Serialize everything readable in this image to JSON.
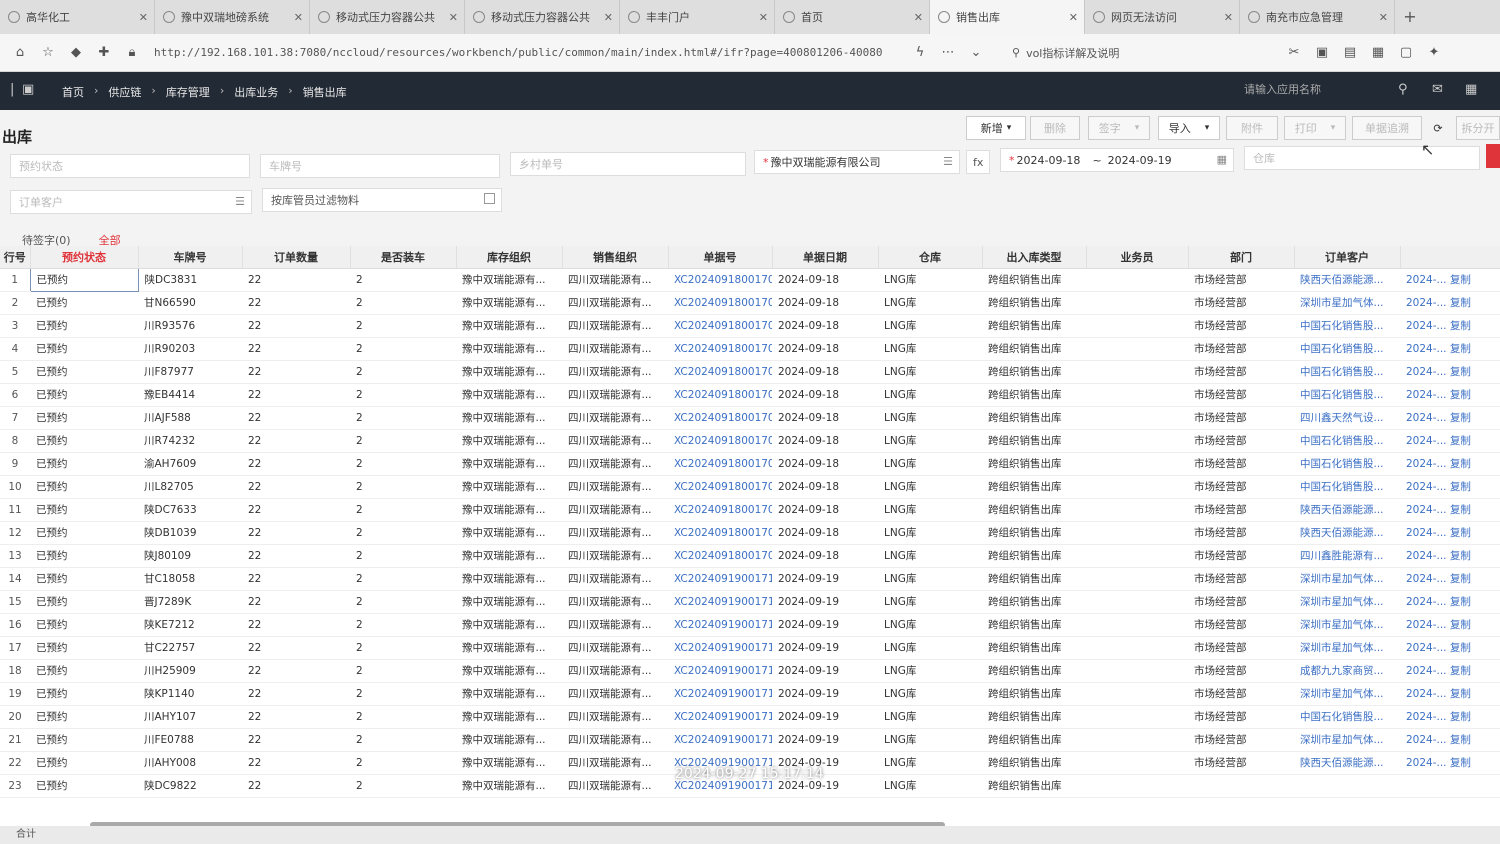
{
  "browser": {
    "tabs": [
      {
        "label": "高华化工",
        "active": false
      },
      {
        "label": "豫中双瑞地磅系统",
        "active": false
      },
      {
        "label": "移动式压力容器公共",
        "active": false
      },
      {
        "label": "移动式压力容器公共",
        "active": false
      },
      {
        "label": "丰丰门户",
        "active": false
      },
      {
        "label": "首页",
        "active": false
      },
      {
        "label": "销售出库",
        "active": true
      },
      {
        "label": "网页无法访问",
        "active": false
      },
      {
        "label": "南充市应急管理",
        "active": false
      }
    ],
    "url": "http://192.168.101.38:7080/nccloud/resources/workbench/public/common/main/index.html#/ifr?page=400801206-40080",
    "search_text": "vol指标详解及说明"
  },
  "topnav": {
    "breadcrumbs": [
      "首页",
      "供应链",
      "库存管理",
      "出库业务",
      "销售出库"
    ],
    "app_search_placeholder": "请输入应用名称"
  },
  "page": {
    "title": "出库",
    "toolbar": {
      "add": "新增",
      "delete": "删除",
      "sign": "签字",
      "import": "导入",
      "attach": "附件",
      "print": "打印",
      "track": "单据追溯",
      "split": "拆分开"
    },
    "filters": {
      "status_placeholder": "预约状态",
      "plate_placeholder": "车牌号",
      "village_placeholder": "乡村单号",
      "org_value": "豫中双瑞能源有限公司",
      "date_from": "2024-09-18",
      "date_to": "2024-09-19",
      "warehouse_placeholder": "仓库",
      "customer_placeholder": "订单客户",
      "material_filter_label": "按库管员过滤物料"
    },
    "subtabs": {
      "pending": "待签字(0)",
      "all": "全部"
    }
  },
  "table": {
    "columns": [
      "行号",
      "预约状态",
      "车牌号",
      "订单数量",
      "是否装车",
      "库存组织",
      "销售组织",
      "单据号",
      "单据日期",
      "仓库",
      "出入库类型",
      "业务员",
      "部门",
      "订单客户",
      ""
    ],
    "rows": [
      {
        "n": "1",
        "status": "已预约",
        "plate": "陕DC3831",
        "qty": "22",
        "load": "2",
        "stock_org": "豫中双瑞能源有...",
        "sales_org": "四川双瑞能源有...",
        "bill": "XC2024091800170...",
        "date": "2024-09-18",
        "wh": "LNG库",
        "type": "跨组织销售出库",
        "clerk": "",
        "dept": "市场经营部",
        "cust": "陕西天佰源能源...",
        "extra": "2024-... 复制"
      },
      {
        "n": "2",
        "status": "已预约",
        "plate": "甘N66590",
        "qty": "22",
        "load": "2",
        "stock_org": "豫中双瑞能源有...",
        "sales_org": "四川双瑞能源有...",
        "bill": "XC2024091800170...",
        "date": "2024-09-18",
        "wh": "LNG库",
        "type": "跨组织销售出库",
        "clerk": "",
        "dept": "市场经营部",
        "cust": "深圳市星加气体...",
        "extra": "2024-... 复制"
      },
      {
        "n": "3",
        "status": "已预约",
        "plate": "川R93576",
        "qty": "22",
        "load": "2",
        "stock_org": "豫中双瑞能源有...",
        "sales_org": "四川双瑞能源有...",
        "bill": "XC2024091800170...",
        "date": "2024-09-18",
        "wh": "LNG库",
        "type": "跨组织销售出库",
        "clerk": "",
        "dept": "市场经营部",
        "cust": "中国石化销售股...",
        "extra": "2024-... 复制"
      },
      {
        "n": "4",
        "status": "已预约",
        "plate": "川R90203",
        "qty": "22",
        "load": "2",
        "stock_org": "豫中双瑞能源有...",
        "sales_org": "四川双瑞能源有...",
        "bill": "XC2024091800170...",
        "date": "2024-09-18",
        "wh": "LNG库",
        "type": "跨组织销售出库",
        "clerk": "",
        "dept": "市场经营部",
        "cust": "中国石化销售股...",
        "extra": "2024-... 复制"
      },
      {
        "n": "5",
        "status": "已预约",
        "plate": "川F87977",
        "qty": "22",
        "load": "2",
        "stock_org": "豫中双瑞能源有...",
        "sales_org": "四川双瑞能源有...",
        "bill": "XC2024091800170...",
        "date": "2024-09-18",
        "wh": "LNG库",
        "type": "跨组织销售出库",
        "clerk": "",
        "dept": "市场经营部",
        "cust": "中国石化销售股...",
        "extra": "2024-... 复制"
      },
      {
        "n": "6",
        "status": "已预约",
        "plate": "豫EB4414",
        "qty": "22",
        "load": "2",
        "stock_org": "豫中双瑞能源有...",
        "sales_org": "四川双瑞能源有...",
        "bill": "XC2024091800170...",
        "date": "2024-09-18",
        "wh": "LNG库",
        "type": "跨组织销售出库",
        "clerk": "",
        "dept": "市场经营部",
        "cust": "中国石化销售股...",
        "extra": "2024-... 复制"
      },
      {
        "n": "7",
        "status": "已预约",
        "plate": "川AJF588",
        "qty": "22",
        "load": "2",
        "stock_org": "豫中双瑞能源有...",
        "sales_org": "四川双瑞能源有...",
        "bill": "XC2024091800170...",
        "date": "2024-09-18",
        "wh": "LNG库",
        "type": "跨组织销售出库",
        "clerk": "",
        "dept": "市场经营部",
        "cust": "四川鑫天然气设...",
        "extra": "2024-... 复制"
      },
      {
        "n": "8",
        "status": "已预约",
        "plate": "川R74232",
        "qty": "22",
        "load": "2",
        "stock_org": "豫中双瑞能源有...",
        "sales_org": "四川双瑞能源有...",
        "bill": "XC2024091800170...",
        "date": "2024-09-18",
        "wh": "LNG库",
        "type": "跨组织销售出库",
        "clerk": "",
        "dept": "市场经营部",
        "cust": "中国石化销售股...",
        "extra": "2024-... 复制"
      },
      {
        "n": "9",
        "status": "已预约",
        "plate": "渝AH7609",
        "qty": "22",
        "load": "2",
        "stock_org": "豫中双瑞能源有...",
        "sales_org": "四川双瑞能源有...",
        "bill": "XC2024091800170...",
        "date": "2024-09-18",
        "wh": "LNG库",
        "type": "跨组织销售出库",
        "clerk": "",
        "dept": "市场经营部",
        "cust": "中国石化销售股...",
        "extra": "2024-... 复制"
      },
      {
        "n": "10",
        "status": "已预约",
        "plate": "川L82705",
        "qty": "22",
        "load": "2",
        "stock_org": "豫中双瑞能源有...",
        "sales_org": "四川双瑞能源有...",
        "bill": "XC2024091800170...",
        "date": "2024-09-18",
        "wh": "LNG库",
        "type": "跨组织销售出库",
        "clerk": "",
        "dept": "市场经营部",
        "cust": "中国石化销售股...",
        "extra": "2024-... 复制"
      },
      {
        "n": "11",
        "status": "已预约",
        "plate": "陕DC7633",
        "qty": "22",
        "load": "2",
        "stock_org": "豫中双瑞能源有...",
        "sales_org": "四川双瑞能源有...",
        "bill": "XC2024091800170...",
        "date": "2024-09-18",
        "wh": "LNG库",
        "type": "跨组织销售出库",
        "clerk": "",
        "dept": "市场经营部",
        "cust": "陕西天佰源能源...",
        "extra": "2024-... 复制"
      },
      {
        "n": "12",
        "status": "已预约",
        "plate": "陕DB1039",
        "qty": "22",
        "load": "2",
        "stock_org": "豫中双瑞能源有...",
        "sales_org": "四川双瑞能源有...",
        "bill": "XC2024091800170...",
        "date": "2024-09-18",
        "wh": "LNG库",
        "type": "跨组织销售出库",
        "clerk": "",
        "dept": "市场经营部",
        "cust": "陕西天佰源能源...",
        "extra": "2024-... 复制"
      },
      {
        "n": "13",
        "status": "已预约",
        "plate": "陕J80109",
        "qty": "22",
        "load": "2",
        "stock_org": "豫中双瑞能源有...",
        "sales_org": "四川双瑞能源有...",
        "bill": "XC2024091800170...",
        "date": "2024-09-18",
        "wh": "LNG库",
        "type": "跨组织销售出库",
        "clerk": "",
        "dept": "市场经营部",
        "cust": "四川鑫胜能源有...",
        "extra": "2024-... 复制"
      },
      {
        "n": "14",
        "status": "已预约",
        "plate": "甘C18058",
        "qty": "22",
        "load": "2",
        "stock_org": "豫中双瑞能源有...",
        "sales_org": "四川双瑞能源有...",
        "bill": "XC2024091900171...",
        "date": "2024-09-19",
        "wh": "LNG库",
        "type": "跨组织销售出库",
        "clerk": "",
        "dept": "市场经营部",
        "cust": "深圳市星加气体...",
        "extra": "2024-... 复制"
      },
      {
        "n": "15",
        "status": "已预约",
        "plate": "晋J7289K",
        "qty": "22",
        "load": "2",
        "stock_org": "豫中双瑞能源有...",
        "sales_org": "四川双瑞能源有...",
        "bill": "XC2024091900171...",
        "date": "2024-09-19",
        "wh": "LNG库",
        "type": "跨组织销售出库",
        "clerk": "",
        "dept": "市场经营部",
        "cust": "深圳市星加气体...",
        "extra": "2024-... 复制"
      },
      {
        "n": "16",
        "status": "已预约",
        "plate": "陕KE7212",
        "qty": "22",
        "load": "2",
        "stock_org": "豫中双瑞能源有...",
        "sales_org": "四川双瑞能源有...",
        "bill": "XC2024091900171...",
        "date": "2024-09-19",
        "wh": "LNG库",
        "type": "跨组织销售出库",
        "clerk": "",
        "dept": "市场经营部",
        "cust": "深圳市星加气体...",
        "extra": "2024-... 复制"
      },
      {
        "n": "17",
        "status": "已预约",
        "plate": "甘C22757",
        "qty": "22",
        "load": "2",
        "stock_org": "豫中双瑞能源有...",
        "sales_org": "四川双瑞能源有...",
        "bill": "XC2024091900171...",
        "date": "2024-09-19",
        "wh": "LNG库",
        "type": "跨组织销售出库",
        "clerk": "",
        "dept": "市场经营部",
        "cust": "深圳市星加气体...",
        "extra": "2024-... 复制"
      },
      {
        "n": "18",
        "status": "已预约",
        "plate": "川H25909",
        "qty": "22",
        "load": "2",
        "stock_org": "豫中双瑞能源有...",
        "sales_org": "四川双瑞能源有...",
        "bill": "XC2024091900171...",
        "date": "2024-09-19",
        "wh": "LNG库",
        "type": "跨组织销售出库",
        "clerk": "",
        "dept": "市场经营部",
        "cust": "成都九九家商贸...",
        "extra": "2024-... 复制"
      },
      {
        "n": "19",
        "status": "已预约",
        "plate": "陕KP1140",
        "qty": "22",
        "load": "2",
        "stock_org": "豫中双瑞能源有...",
        "sales_org": "四川双瑞能源有...",
        "bill": "XC2024091900171...",
        "date": "2024-09-19",
        "wh": "LNG库",
        "type": "跨组织销售出库",
        "clerk": "",
        "dept": "市场经营部",
        "cust": "深圳市星加气体...",
        "extra": "2024-... 复制"
      },
      {
        "n": "20",
        "status": "已预约",
        "plate": "川AHY107",
        "qty": "22",
        "load": "2",
        "stock_org": "豫中双瑞能源有...",
        "sales_org": "四川双瑞能源有...",
        "bill": "XC2024091900171...",
        "date": "2024-09-19",
        "wh": "LNG库",
        "type": "跨组织销售出库",
        "clerk": "",
        "dept": "市场经营部",
        "cust": "中国石化销售股...",
        "extra": "2024-... 复制"
      },
      {
        "n": "21",
        "status": "已预约",
        "plate": "川FE0788",
        "qty": "22",
        "load": "2",
        "stock_org": "豫中双瑞能源有...",
        "sales_org": "四川双瑞能源有...",
        "bill": "XC2024091900171...",
        "date": "2024-09-19",
        "wh": "LNG库",
        "type": "跨组织销售出库",
        "clerk": "",
        "dept": "市场经营部",
        "cust": "深圳市星加气体...",
        "extra": "2024-... 复制"
      },
      {
        "n": "22",
        "status": "已预约",
        "plate": "川AHY008",
        "qty": "22",
        "load": "2",
        "stock_org": "豫中双瑞能源有...",
        "sales_org": "四川双瑞能源有...",
        "bill": "XC2024091900171...",
        "date": "2024-09-19",
        "wh": "LNG库",
        "type": "跨组织销售出库",
        "clerk": "",
        "dept": "市场经营部",
        "cust": "陕西天佰源能源...",
        "extra": "2024-... 复制"
      },
      {
        "n": "23",
        "status": "已预约",
        "plate": "陕DC9822",
        "qty": "22",
        "load": "2",
        "stock_org": "豫中双瑞能源有...",
        "sales_org": "四川双瑞能源有...",
        "bill": "XC2024091900171...",
        "date": "2024-09-19",
        "wh": "LNG库",
        "type": "跨组织销售出库",
        "clerk": "",
        "dept": "",
        "cust": "",
        "extra": ""
      }
    ]
  },
  "footer": {
    "label": "合计"
  },
  "timestamp": "2024-09-27 15:17:14",
  "colors": {
    "accent": "#e0343b",
    "link": "#3b6fc4",
    "nav_bg": "#222a35"
  }
}
